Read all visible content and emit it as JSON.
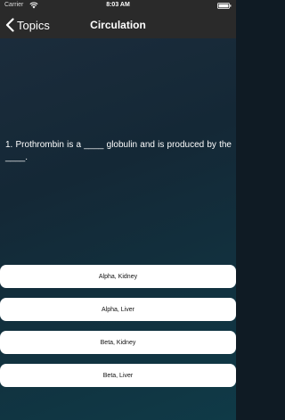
{
  "status_bar": {
    "carrier": "Carrier",
    "time": "8:03 AM"
  },
  "nav": {
    "back_label": "Topics",
    "title": "Circulation"
  },
  "question": {
    "text": "1. Prothrombin is a ____ globulin and is produced by the ____."
  },
  "answers": [
    "Alpha, Kidney",
    "Alpha, Liver",
    "Beta, Kidney",
    "Beta, Liver"
  ],
  "colors": {
    "bar_background": "#2a2a2a",
    "gradient_start": "#1d2d3d",
    "gradient_end": "#0f3a47",
    "answer_background": "#ffffff"
  }
}
